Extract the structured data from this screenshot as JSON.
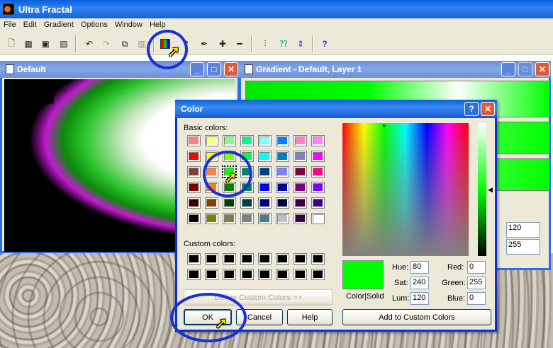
{
  "app": {
    "title": "Ultra Fractal"
  },
  "menu": [
    "File",
    "Edit",
    "Gradient",
    "Options",
    "Window",
    "Help"
  ],
  "windows": {
    "fractal_title": "Default",
    "gradient_title": "Gradient - Default, Layer 1",
    "gradient_values": {
      "a": "120",
      "b": "255"
    }
  },
  "dialog": {
    "title": "Color",
    "help_glyph": "?",
    "close_glyph": "✕",
    "basic_colors_label": "Basic colors:",
    "custom_colors_label": "Custom colors:",
    "define_button": "Define Custom Colors >>",
    "ok": "OK",
    "cancel": "Cancel",
    "help": "Help",
    "add_custom": "Add to Custom Colors",
    "color_solid_label": "Color|Solid",
    "hue_label": "Hue:",
    "hue": "80",
    "sat_label": "Sat:",
    "sat": "240",
    "lum_label": "Lum:",
    "lum": "120",
    "red_label": "Red:",
    "red": "0",
    "green_label": "Green:",
    "green": "255",
    "blue_label": "Blue:",
    "blue": "0"
  },
  "basic_colors": [
    "#ff8080",
    "#ffff80",
    "#80ff80",
    "#00ff80",
    "#80ffff",
    "#0080ff",
    "#ff80c0",
    "#ff80ff",
    "#ff0000",
    "#ffff00",
    "#80ff00",
    "#00ff40",
    "#00ffff",
    "#0080c0",
    "#8080c0",
    "#ff00ff",
    "#804040",
    "#ff8040",
    "#00ff00",
    "#008080",
    "#004080",
    "#8080ff",
    "#800040",
    "#ff0080",
    "#800000",
    "#ff8000",
    "#008000",
    "#008040",
    "#0000ff",
    "#0000a0",
    "#800080",
    "#8000ff",
    "#400000",
    "#804000",
    "#004000",
    "#004040",
    "#000080",
    "#000040",
    "#400040",
    "#400080",
    "#000000",
    "#808000",
    "#808040",
    "#808080",
    "#408080",
    "#c0c0c0",
    "#400040",
    "#ffffff"
  ],
  "custom_colors": [
    "#000000",
    "#000000",
    "#000000",
    "#000000",
    "#000000",
    "#000000",
    "#000000",
    "#000000",
    "#000000",
    "#000000",
    "#000000",
    "#000000",
    "#000000",
    "#000000",
    "#000000",
    "#000000"
  ],
  "colors": {
    "selected": "#00ff00",
    "highlight_ring": "#1a2fd8"
  },
  "toolbar_icons": [
    "new-icon",
    "open-icon",
    "save-icon",
    "save-all-icon",
    "undo-icon",
    "redo-icon",
    "copy-icon",
    "paste-icon",
    "gradient-color-icon",
    "help-q-icon",
    "eyedropper-icon",
    "add-point-icon",
    "remove-point-icon",
    "adjust-icon",
    "random-icon",
    "arrows-icon",
    "help-icon"
  ]
}
